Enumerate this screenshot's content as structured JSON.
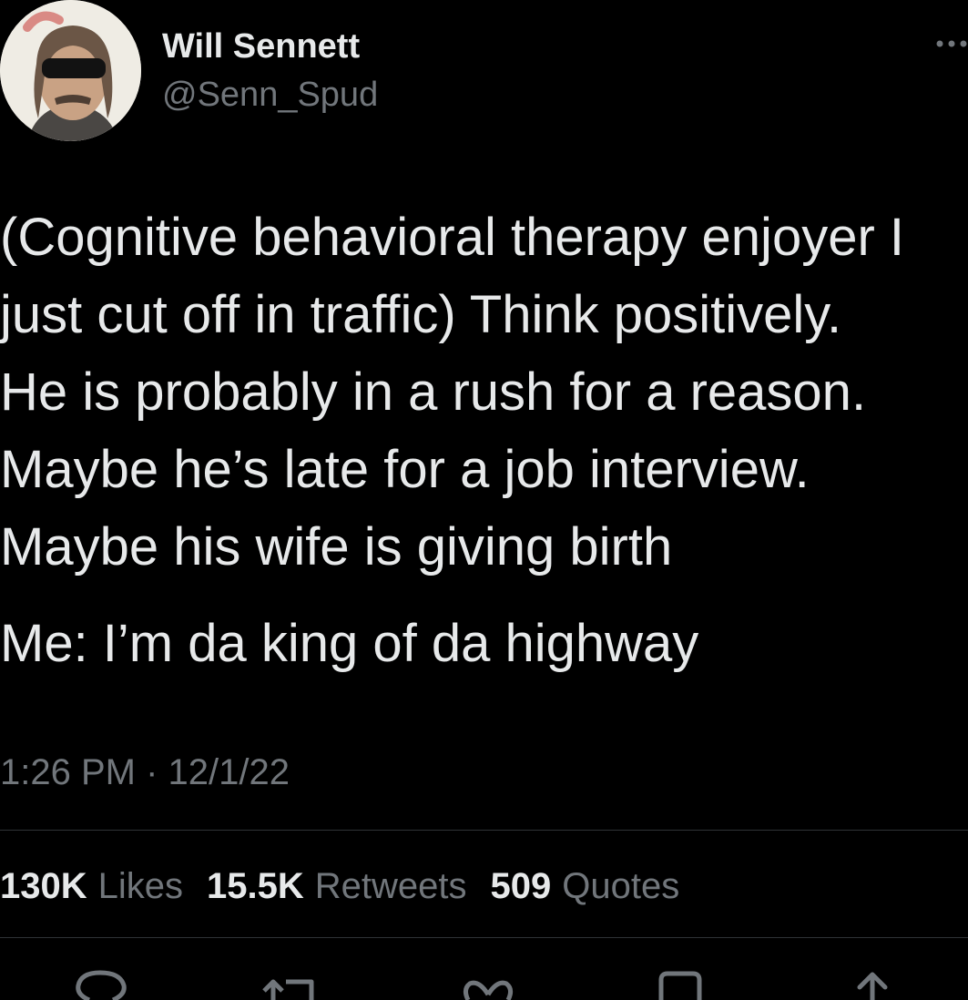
{
  "author": {
    "display_name": "Will Sennett",
    "handle": "@Senn_Spud",
    "avatar_icon": "profile-photo"
  },
  "tweet": {
    "lines": [
      "(Cognitive behavioral therapy enjoyer I",
      "just cut off in traffic) Think positively.",
      "He is probably in a rush for a reason.",
      "Maybe he’s late for a job interview.",
      "Maybe his wife is giving birth",
      "Me: I’m da king of da highway"
    ]
  },
  "timestamp": "1:26 PM · 12/1/22",
  "stats": {
    "likes_count": "130K",
    "likes_label": "Likes",
    "retweets_count": "15.5K",
    "retweets_label": "Retweets",
    "quotes_count": "509",
    "quotes_label": "Quotes"
  },
  "actions": [
    {
      "icon": "reply-icon"
    },
    {
      "icon": "retweet-icon"
    },
    {
      "icon": "like-icon"
    },
    {
      "icon": "bookmark-icon"
    },
    {
      "icon": "share-icon"
    }
  ],
  "colors": {
    "background": "#000000",
    "primary_text": "#e7e9ea",
    "secondary_text": "#71767b",
    "divider": "#2f3336"
  }
}
